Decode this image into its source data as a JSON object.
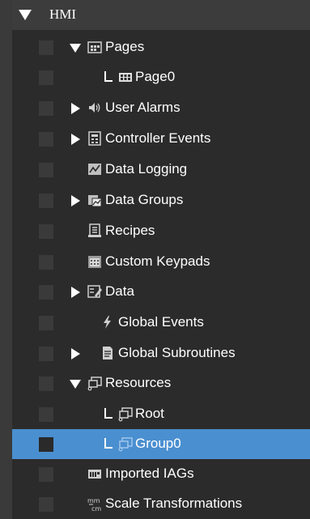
{
  "tree": {
    "root_label": "HMI",
    "items": [
      {
        "label": "Pages",
        "icon": "pages-icon",
        "expander": "expanded"
      },
      {
        "label": "Page0",
        "icon": "page-icon",
        "expander": "child"
      },
      {
        "label": "User Alarms",
        "icon": "speaker-icon",
        "expander": "collapsed"
      },
      {
        "label": "Controller Events",
        "icon": "controller-events-icon",
        "expander": "collapsed"
      },
      {
        "label": "Data Logging",
        "icon": "data-logging-icon",
        "expander": "none"
      },
      {
        "label": "Data Groups",
        "icon": "data-groups-icon",
        "expander": "collapsed"
      },
      {
        "label": "Recipes",
        "icon": "recipes-icon",
        "expander": "none"
      },
      {
        "label": "Custom Keypads",
        "icon": "keypad-icon",
        "expander": "none"
      },
      {
        "label": "Data",
        "icon": "data-icon",
        "expander": "collapsed"
      },
      {
        "label": "Global Events",
        "icon": "lightning-icon",
        "expander": "none"
      },
      {
        "label": "Global Subroutines",
        "icon": "subroutines-icon",
        "expander": "collapsed"
      },
      {
        "label": "Resources",
        "icon": "resources-icon",
        "expander": "expanded"
      },
      {
        "label": "Root",
        "icon": "resource-folder-icon",
        "expander": "child"
      },
      {
        "label": "Group0",
        "icon": "resource-folder-icon",
        "expander": "child",
        "selected": true
      },
      {
        "label": "Imported IAGs",
        "icon": "iag-icon",
        "expander": "none"
      },
      {
        "label": "Scale Transformations",
        "icon": "scale-icon",
        "expander": "none"
      }
    ]
  },
  "colors": {
    "background": "#2b2b2b",
    "selection": "#4a8fd0",
    "text": "#ffffff"
  }
}
